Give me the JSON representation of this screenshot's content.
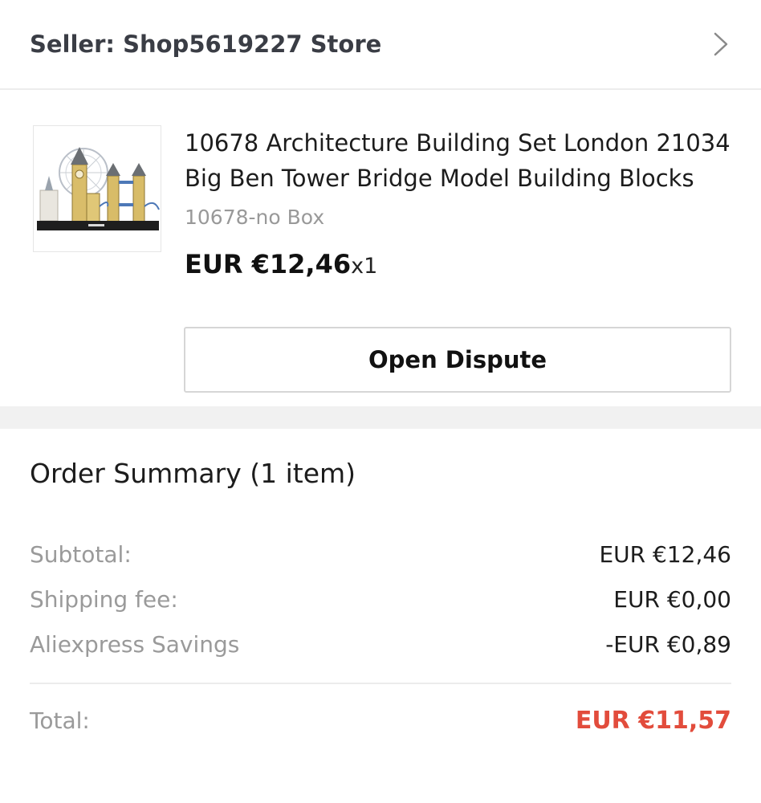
{
  "seller": {
    "label": "Seller: Shop5619227 Store",
    "chevron_icon": "chevron-right-icon"
  },
  "product": {
    "image_icon": "product-thumbnail-london-skyline",
    "title": "10678 Architecture Building Set London 21034 Big Ben Tower Bridge Model Building Blocks",
    "variant": "10678-no Box",
    "price": "EUR €12,46",
    "quantity": "x1",
    "dispute_label": "Open Dispute"
  },
  "summary": {
    "title": "Order Summary (1 item)",
    "rows": [
      {
        "label": "Subtotal:",
        "value": "EUR €12,46"
      },
      {
        "label": "Shipping fee:",
        "value": "EUR €0,00"
      },
      {
        "label": "Aliexpress Savings",
        "value": "-EUR €0,89"
      }
    ],
    "total": {
      "label": "Total:",
      "value": "EUR €11,57"
    }
  },
  "colors": {
    "total_accent": "#e24c3c",
    "muted_text": "#9a9a9a",
    "section_gap": "#f1f1f1"
  }
}
